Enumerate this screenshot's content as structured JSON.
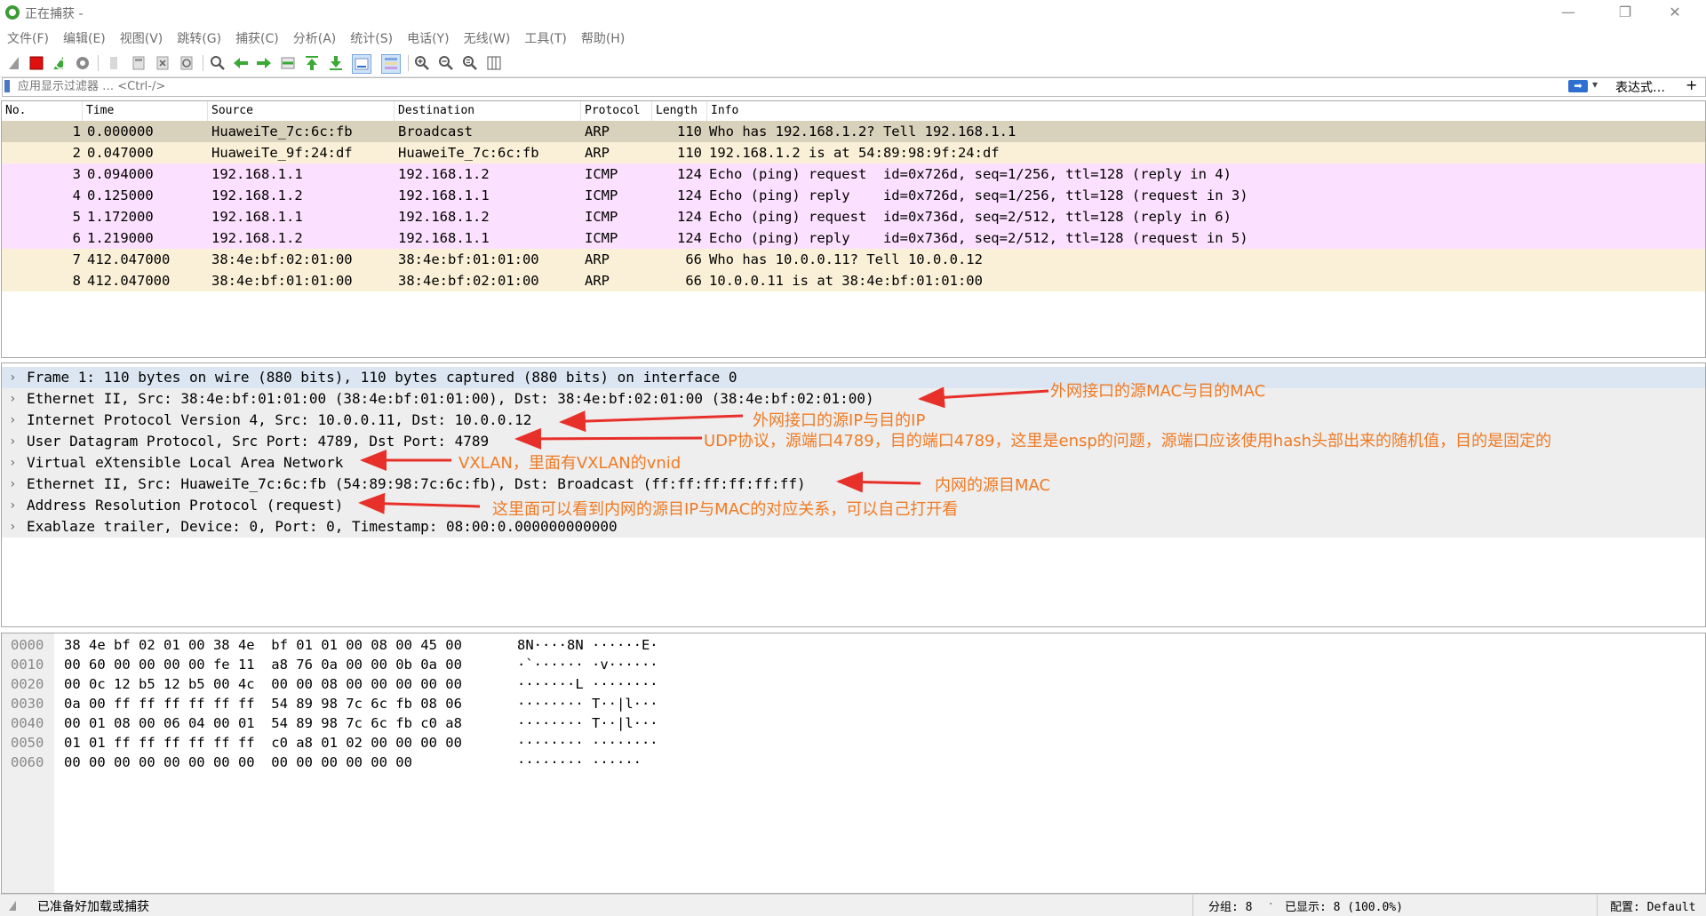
{
  "window": {
    "title": "正在捕获 -",
    "minimize": "—",
    "restore": "❐",
    "close": "✕"
  },
  "menu": [
    "文件(F)",
    "编辑(E)",
    "视图(V)",
    "跳转(G)",
    "捕获(C)",
    "分析(A)",
    "统计(S)",
    "电话(Y)",
    "无线(W)",
    "工具(T)",
    "帮助(H)"
  ],
  "toolbar": {
    "icons": [
      "shark-fin-start-icon",
      "stop-capture-icon",
      "restart-capture-icon",
      "capture-options-icon",
      "open-file-icon",
      "save-file-icon",
      "close-file-icon",
      "reload-file-icon",
      "find-packet-icon",
      "go-back-icon",
      "go-forward-icon",
      "go-to-packet-icon",
      "go-first-icon",
      "go-last-icon",
      "autoscroll-icon",
      "colorize-icon",
      "zoom-in-icon",
      "zoom-out-icon",
      "zoom-normal-icon",
      "resize-columns-icon"
    ]
  },
  "filter": {
    "placeholder": "应用显示过滤器 … <Ctrl-/>",
    "expression_label": "表达式…",
    "add_label": "+"
  },
  "packet_list": {
    "columns": [
      "No.",
      "Time",
      "Source",
      "Destination",
      "Protocol",
      "Length",
      "Info"
    ],
    "rows": [
      {
        "no": "1",
        "time": "0.000000",
        "src": "HuaweiTe_7c:6c:fb",
        "dst": "Broadcast",
        "proto": "ARP",
        "len": "110",
        "info": "Who has 192.168.1.2? Tell 192.168.1.1",
        "bg": "#d8d1bb"
      },
      {
        "no": "2",
        "time": "0.047000",
        "src": "HuaweiTe_9f:24:df",
        "dst": "HuaweiTe_7c:6c:fb",
        "proto": "ARP",
        "len": "110",
        "info": "192.168.1.2 is at 54:89:98:9f:24:df",
        "bg": "#faf0d7"
      },
      {
        "no": "3",
        "time": "0.094000",
        "src": "192.168.1.1",
        "dst": "192.168.1.2",
        "proto": "ICMP",
        "len": "124",
        "info": "Echo (ping) request  id=0x726d, seq=1/256, ttl=128 (reply in 4)",
        "bg": "#fce0ff"
      },
      {
        "no": "4",
        "time": "0.125000",
        "src": "192.168.1.2",
        "dst": "192.168.1.1",
        "proto": "ICMP",
        "len": "124",
        "info": "Echo (ping) reply    id=0x726d, seq=1/256, ttl=128 (request in 3)",
        "bg": "#fce0ff"
      },
      {
        "no": "5",
        "time": "1.172000",
        "src": "192.168.1.1",
        "dst": "192.168.1.2",
        "proto": "ICMP",
        "len": "124",
        "info": "Echo (ping) request  id=0x736d, seq=2/512, ttl=128 (reply in 6)",
        "bg": "#fce0ff"
      },
      {
        "no": "6",
        "time": "1.219000",
        "src": "192.168.1.2",
        "dst": "192.168.1.1",
        "proto": "ICMP",
        "len": "124",
        "info": "Echo (ping) reply    id=0x736d, seq=2/512, ttl=128 (request in 5)",
        "bg": "#fce0ff"
      },
      {
        "no": "7",
        "time": "412.047000",
        "src": "38:4e:bf:02:01:00",
        "dst": "38:4e:bf:01:01:00",
        "proto": "ARP",
        "len": "66",
        "info": "Who has 10.0.0.11? Tell 10.0.0.12",
        "bg": "#faf0d7"
      },
      {
        "no": "8",
        "time": "412.047000",
        "src": "38:4e:bf:01:01:00",
        "dst": "38:4e:bf:02:01:00",
        "proto": "ARP",
        "len": "66",
        "info": "10.0.0.11 is at 38:4e:bf:01:01:00",
        "bg": "#faf0d7"
      }
    ]
  },
  "details": [
    {
      "text": "Frame 1: 110 bytes on wire (880 bits), 110 bytes captured (880 bits) on interface 0",
      "selected": true
    },
    {
      "text": "Ethernet II, Src: 38:4e:bf:01:01:00 (38:4e:bf:01:01:00), Dst: 38:4e:bf:02:01:00 (38:4e:bf:02:01:00)"
    },
    {
      "text": "Internet Protocol Version 4, Src: 10.0.0.11, Dst: 10.0.0.12"
    },
    {
      "text": "User Datagram Protocol, Src Port: 4789, Dst Port: 4789"
    },
    {
      "text": "Virtual eXtensible Local Area Network"
    },
    {
      "text": "Ethernet II, Src: HuaweiTe_7c:6c:fb (54:89:98:7c:6c:fb), Dst: Broadcast (ff:ff:ff:ff:ff:ff)"
    },
    {
      "text": "Address Resolution Protocol (request)"
    },
    {
      "text": "Exablaze trailer, Device: 0, Port: 0, Timestamp: 08:00:0.000000000000"
    }
  ],
  "annotations": [
    "外网接口的源MAC与目的MAC",
    "外网接口的源IP与目的IP",
    "UDP协议，源端口4789，目的端口4789，这里是ensp的问题，源端口应该使用hash头部出来的随机值，目的是固定的",
    "VXLAN，里面有VXLAN的vnid",
    "内网的源目MAC",
    "这里面可以看到内网的源目IP与MAC的对应关系，可以自己打开看"
  ],
  "annotation_color": "#f07a24",
  "bytes": [
    {
      "off": "0000",
      "hex": "38 4e bf 02 01 00 38 4e  bf 01 01 00 08 00 45 00",
      "ascii": "8N····8N ······E·"
    },
    {
      "off": "0010",
      "hex": "00 60 00 00 00 00 fe 11  a8 76 0a 00 00 0b 0a 00",
      "ascii": "·`······ ·v······"
    },
    {
      "off": "0020",
      "hex": "00 0c 12 b5 12 b5 00 4c  00 00 08 00 00 00 00 00",
      "ascii": "·······L ········"
    },
    {
      "off": "0030",
      "hex": "0a 00 ff ff ff ff ff ff  54 89 98 7c 6c fb 08 06",
      "ascii": "········ T··|l···"
    },
    {
      "off": "0040",
      "hex": "00 01 08 00 06 04 00 01  54 89 98 7c 6c fb c0 a8",
      "ascii": "········ T··|l···"
    },
    {
      "off": "0050",
      "hex": "01 01 ff ff ff ff ff ff  c0 a8 01 02 00 00 00 00",
      "ascii": "········ ········"
    },
    {
      "off": "0060",
      "hex": "00 00 00 00 00 00 00 00  00 00 00 00 00 00",
      "ascii": "········ ······"
    }
  ],
  "status": {
    "ready": "已准备好加载或捕获",
    "packets": "分组: 8",
    "displayed": "已显示: 8 (100.0%)",
    "profile": "配置: Default"
  }
}
